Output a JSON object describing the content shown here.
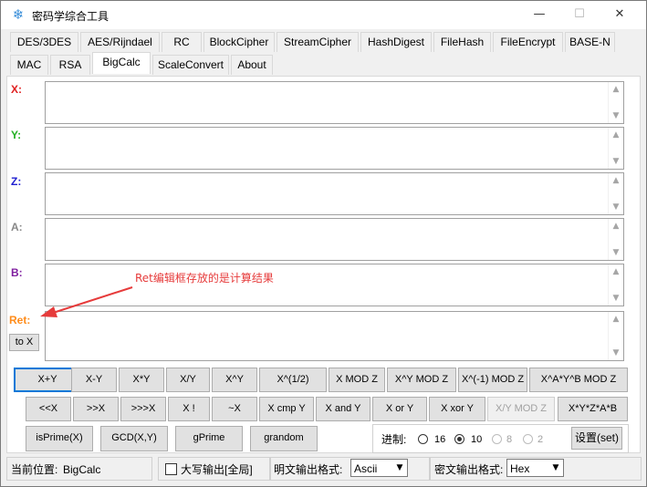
{
  "window": {
    "title": "密码学综合工具",
    "app_icon": "snowflake-icon",
    "minimize": "—",
    "maximize": "☐",
    "close": "✕"
  },
  "tabs_row1": [
    "DES/3DES",
    "AES/Rijndael",
    "RC",
    "BlockCipher",
    "StreamCipher",
    "HashDigest",
    "FileHash",
    "FileEncrypt",
    "BASE-N"
  ],
  "tabs_row2": [
    "MAC",
    "RSA",
    "BigCalc",
    "ScaleConvert",
    "About"
  ],
  "active_tab": "BigCalc",
  "fields": {
    "x": {
      "label": "X:",
      "color": "#e02020",
      "value": ""
    },
    "y": {
      "label": "Y:",
      "color": "#22b022",
      "value": ""
    },
    "z": {
      "label": "Z:",
      "color": "#2020d0",
      "value": ""
    },
    "a": {
      "label": "A:",
      "color": "#888888",
      "value": ""
    },
    "b": {
      "label": "B:",
      "color": "#8020a0",
      "value": ""
    },
    "ret": {
      "label": "Ret:",
      "color": "#ff8c1a",
      "value": ""
    }
  },
  "to_x_label": "to X",
  "annotation": {
    "text": "Ret编辑框存放的是计算结果",
    "color": "#e63b3b"
  },
  "buttons_row1": [
    "X+Y",
    "X-Y",
    "X*Y",
    "X/Y",
    "X^Y",
    "X^(1/2)",
    "X MOD Z",
    "X^Y MOD Z",
    "X^(-1) MOD Z",
    "X^A*Y^B MOD Z"
  ],
  "buttons_row2": [
    "<<X",
    ">>X",
    ">>>X",
    "X !",
    "~X",
    "X cmp Y",
    "X and Y",
    "X or Y",
    "X xor Y",
    "X/Y MOD Z",
    "X*Y*Z*A*B"
  ],
  "buttons_row3": [
    "isPrime(X)",
    "GCD(X,Y)",
    "gPrime",
    "grandom"
  ],
  "radix": {
    "label": "进制:",
    "options": [
      "16",
      "10",
      "8",
      "2"
    ],
    "selected": "10",
    "set_button": "设置(set)"
  },
  "status": {
    "position_label": "当前位置:",
    "position_value": "BigCalc",
    "uppercase_label": "大写输出[全局]",
    "uppercase_checked": false,
    "plain_label": "明文输出格式:",
    "plain_value": "Ascii",
    "cipher_label": "密文输出格式:",
    "cipher_value": "Hex"
  }
}
